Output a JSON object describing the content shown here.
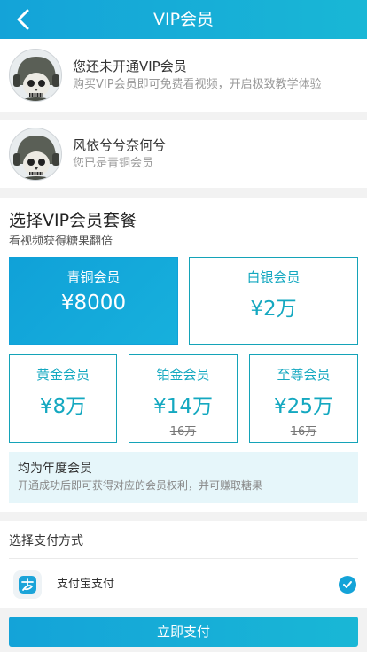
{
  "header": {
    "title": "VIP会员",
    "back_icon": "chevron-left-icon"
  },
  "user_card": {
    "name": "您还未开通VIP会员",
    "subtitle": "购买VIP会员即可免费看视频，开启极致教学体验"
  },
  "member_card": {
    "name": "风依兮兮奈何兮",
    "subtitle": "您已是青铜会员"
  },
  "packages": {
    "title": "选择VIP会员套餐",
    "subtitle": "看视频获得糖果翻倍",
    "tiers": [
      {
        "name": "青铜会员",
        "price": "¥8000",
        "original": "",
        "selected": true
      },
      {
        "name": "白银会员",
        "price": "¥2万",
        "original": "",
        "selected": false
      },
      {
        "name": "黄金会员",
        "price": "¥8万",
        "original": "",
        "selected": false
      },
      {
        "name": "铂金会员",
        "price": "¥14万",
        "original": "16万",
        "selected": false
      },
      {
        "name": "至尊会员",
        "price": "¥25万",
        "original": "16万",
        "selected": false
      }
    ]
  },
  "notice": {
    "title": "均为年度会员",
    "text": "开通成功后即可获得对应的会员权利，并可赚取糖果"
  },
  "payment": {
    "title": "选择支付方式",
    "method_icon": "alipay-icon",
    "method": "支付宝支付",
    "checked": true,
    "button": "立即支付"
  },
  "colors": {
    "accent": "#14a3d8",
    "tier_border": "#14a3b8",
    "notice_bg": "#e6f6fa"
  }
}
